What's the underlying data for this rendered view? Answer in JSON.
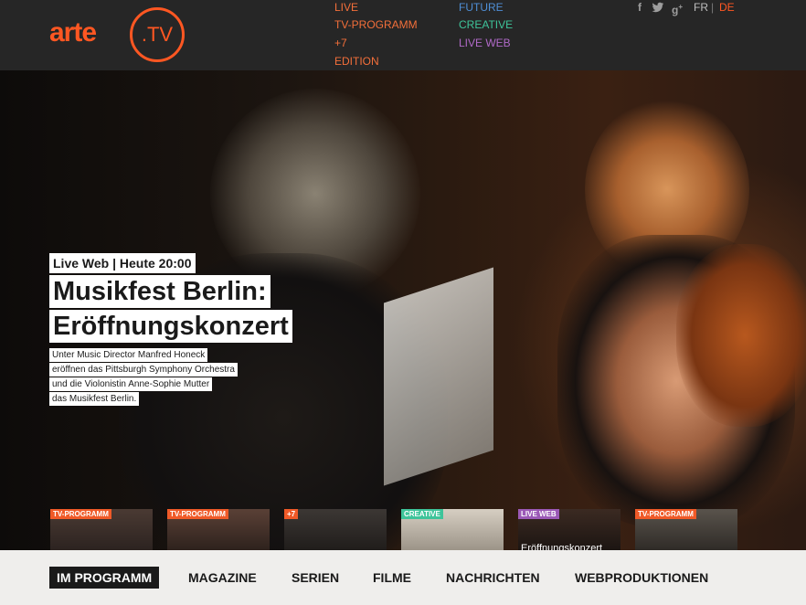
{
  "header": {
    "logo_text": "arte",
    "logo_tv": ".TV",
    "nav_col1": [
      "LIVE",
      "TV-PROGRAMM",
      "+7",
      "EDITION"
    ],
    "nav_col2": [
      {
        "label": "FUTURE",
        "color": "#4f8fd6"
      },
      {
        "label": "CREATIVE",
        "color": "#3ec49a"
      },
      {
        "label": "LIVE WEB",
        "color": "#b06ac8"
      }
    ],
    "social_icons": [
      "facebook-icon",
      "twitter-icon",
      "google-plus-icon"
    ],
    "languages": [
      {
        "label": "FR",
        "active": false
      },
      {
        "label": "DE",
        "active": true
      }
    ],
    "accent_color": "#ff5722"
  },
  "hero": {
    "tag": "Live Web | Heute 20:00",
    "title_lines": [
      "Musikfest Berlin:",
      "Eröffnungskonzert"
    ],
    "description_lines": [
      "Unter Music Director Manfred Honeck",
      "eröffnen das Pittsburgh Symphony Orchestra",
      "und die Violonistin Anne-Sophie Mutter",
      "das Musikfest Berlin."
    ]
  },
  "thumbnails": [
    {
      "badge": "TV-PROGRAMM",
      "badge_color": "#f05a28",
      "caption": ""
    },
    {
      "badge": "TV-PROGRAMM",
      "badge_color": "#f05a28",
      "caption": ""
    },
    {
      "badge": "+7",
      "badge_color": "#f05a28",
      "caption": ""
    },
    {
      "badge": "CREATIVE",
      "badge_color": "#3ec49a",
      "caption": ""
    },
    {
      "badge": "LIVE WEB",
      "badge_color": "#9b59b6",
      "caption": "Eröffnungskonzert"
    },
    {
      "badge": "TV-PROGRAMM",
      "badge_color": "#f05a28",
      "caption": ""
    }
  ],
  "bottom_nav": [
    "IM PROGRAMM",
    "MAGAZINE",
    "SERIEN",
    "FILME",
    "NACHRICHTEN",
    "WEBPRODUKTIONEN"
  ]
}
